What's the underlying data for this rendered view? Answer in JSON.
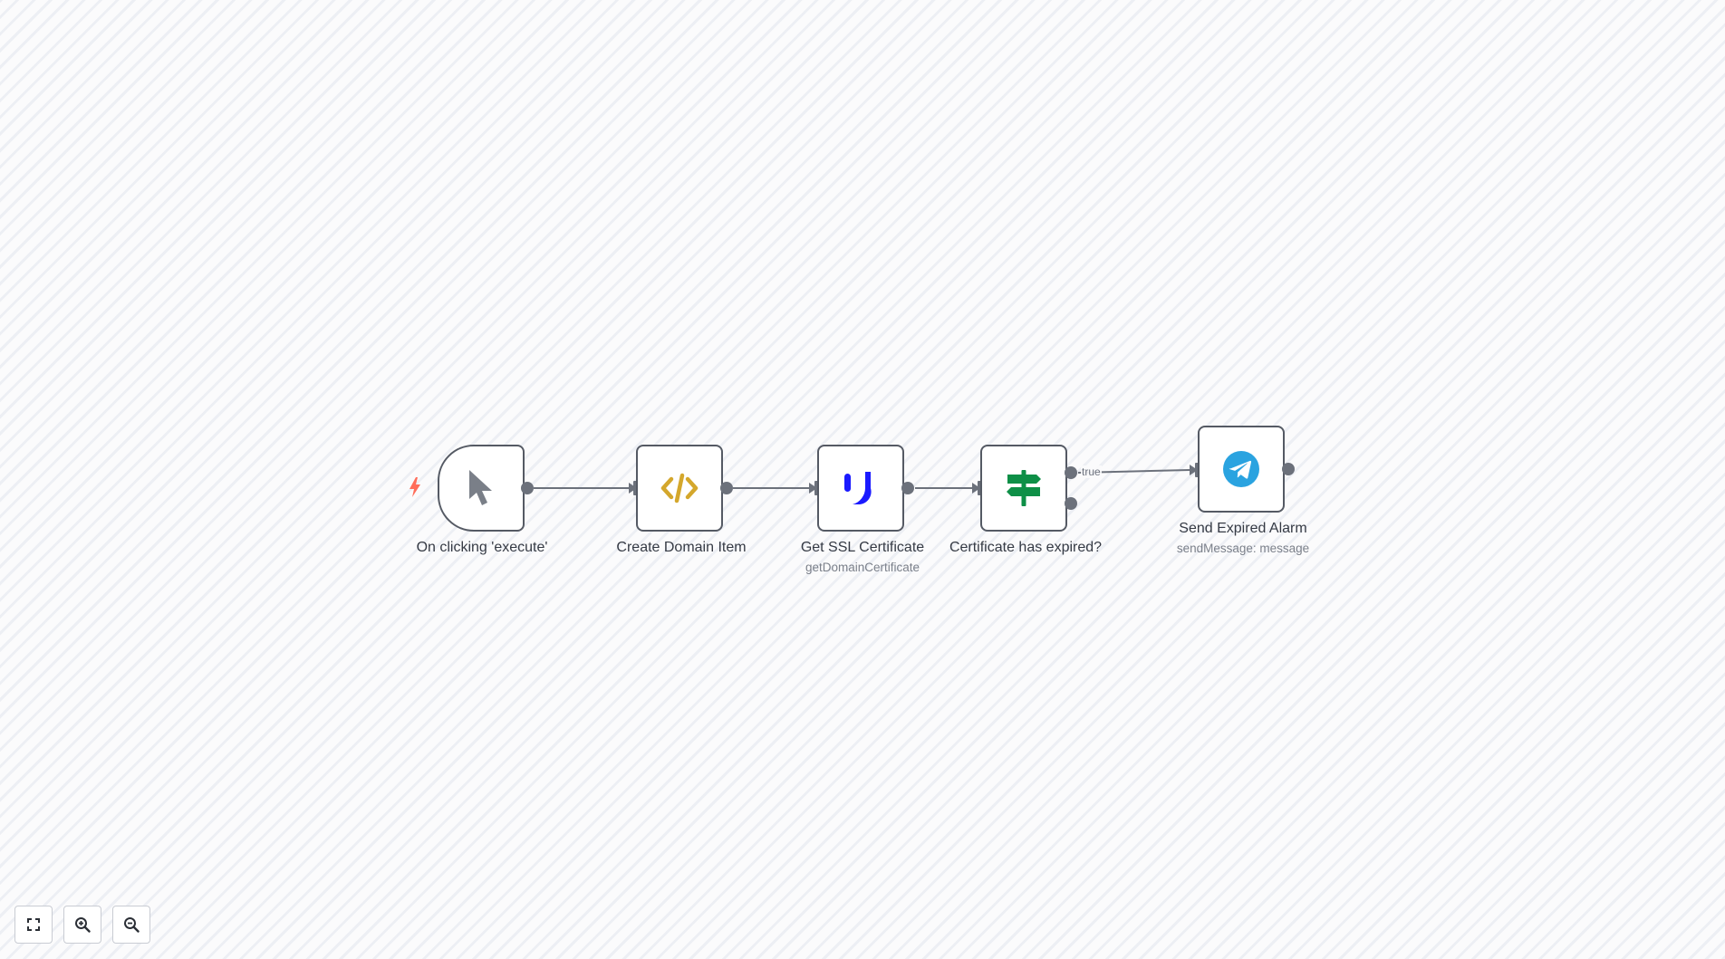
{
  "workflow": {
    "nodes": [
      {
        "label": "On clicking 'execute'",
        "subtitle": "",
        "icon": "mouse-pointer-icon"
      },
      {
        "label": "Create Domain Item",
        "subtitle": "",
        "icon": "code-icon"
      },
      {
        "label": "Get SSL Certificate",
        "subtitle": "getDomainCertificate",
        "icon": "uptime-robot-icon"
      },
      {
        "label": "Certificate has expired?",
        "subtitle": "",
        "icon": "signpost-icon"
      },
      {
        "label": "Send Expired Alarm",
        "subtitle": "sendMessage: message",
        "icon": "telegram-icon"
      }
    ],
    "edge_labels": {
      "if_true": "true"
    }
  },
  "controls": {
    "fit_view": "fit-view-icon",
    "zoom_in": "zoom-in-icon",
    "zoom_out": "zoom-out-icon"
  },
  "colors": {
    "trigger_bolt": "#ff6d5a",
    "code_icon": "#d4a72c",
    "uptime_icon": "#1a1aff",
    "if_icon": "#0e8f47",
    "telegram_icon": "#2aa3e0",
    "edge": "#6c717b"
  }
}
